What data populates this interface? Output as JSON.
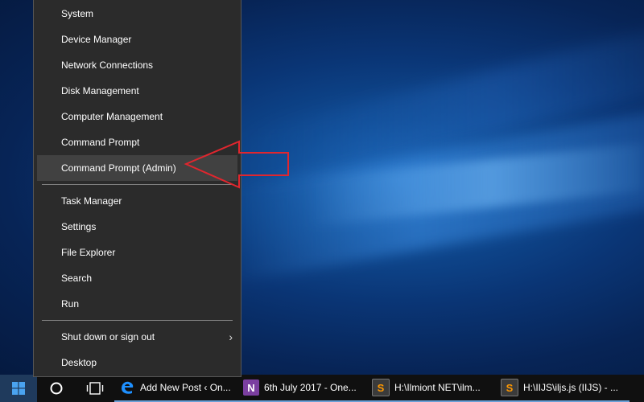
{
  "context_menu": {
    "items_group1": [
      {
        "label": "System"
      },
      {
        "label": "Device Manager"
      },
      {
        "label": "Network Connections"
      },
      {
        "label": "Disk Management"
      },
      {
        "label": "Computer Management"
      },
      {
        "label": "Command Prompt"
      },
      {
        "label": "Command Prompt (Admin)",
        "highlighted": true
      }
    ],
    "items_group2": [
      {
        "label": "Task Manager"
      },
      {
        "label": "Settings"
      },
      {
        "label": "File Explorer"
      },
      {
        "label": "Search"
      },
      {
        "label": "Run"
      }
    ],
    "items_group3": [
      {
        "label": "Shut down or sign out",
        "has_submenu": true
      },
      {
        "label": "Desktop"
      }
    ]
  },
  "annotation": {
    "type": "arrow",
    "color": "#e0262e",
    "points_to": "Command Prompt (Admin)"
  },
  "taskbar": {
    "start_icon": "windows-logo-icon",
    "search_icon": "cortana-circle-icon",
    "task_view_icon": "task-view-icon",
    "apps": [
      {
        "icon": "edge-icon",
        "label": "Add New Post ‹ On...",
        "icon_color": "#1e90ff"
      },
      {
        "icon": "onenote-icon",
        "label": "6th July 2017 - One...",
        "icon_color": "#7b3fa0"
      },
      {
        "icon": "sublime-text-icon",
        "label": "H:\\Ilmiont NET\\ilm...",
        "icon_color": "#ff9800"
      },
      {
        "icon": "sublime-text-icon",
        "label": "H:\\IIJS\\iljs.js (IIJS) - ...",
        "icon_color": "#ff9800"
      }
    ]
  },
  "colors": {
    "menu_bg": "#2b2b2b",
    "menu_highlight": "#414141",
    "taskbar_bg": "#101010",
    "desktop_blue": "#0a3575"
  }
}
